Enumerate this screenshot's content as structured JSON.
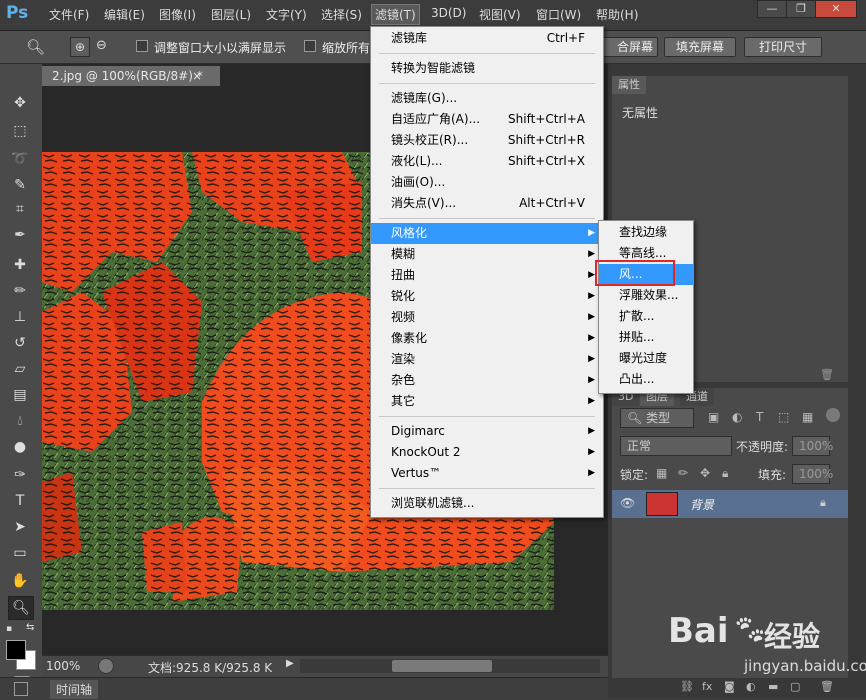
{
  "app": {
    "logo": "Ps"
  },
  "menubar": {
    "items": [
      "文件(F)",
      "编辑(E)",
      "图像(I)",
      "图层(L)",
      "文字(Y)",
      "选择(S)",
      "滤镜(T)",
      "3D(D)",
      "视图(V)",
      "窗口(W)",
      "帮助(H)"
    ],
    "active": "滤镜(T)"
  },
  "window_controls": {
    "minimize": "—",
    "restore": "❐",
    "close": "✕"
  },
  "options_bar": {
    "resize_window_label": "调整窗口大小以满屏显示",
    "zoom_all_label": "缩放所有",
    "fit_screen_label": "合屏幕",
    "fill_screen_label": "填充屏幕",
    "print_size_label": "打印尺寸"
  },
  "document": {
    "tab_title": "2.jpg @ 100%(RGB/8#) *",
    "tab_close": "×",
    "zoom": "100%",
    "doc_size": "文档:925.8 K/925.8 K"
  },
  "timeline_label": "时间轴",
  "filter_menu": {
    "items": [
      {
        "label": "滤镜库",
        "shortcut": "Ctrl+F"
      },
      {
        "label": "转换为智能滤镜",
        "shortcut": ""
      },
      {
        "label": "滤镜库(G)...",
        "shortcut": ""
      },
      {
        "label": "自适应广角(A)...",
        "shortcut": "Shift+Ctrl+A"
      },
      {
        "label": "镜头校正(R)...",
        "shortcut": "Shift+Ctrl+R"
      },
      {
        "label": "液化(L)...",
        "shortcut": "Shift+Ctrl+X"
      },
      {
        "label": "油画(O)...",
        "shortcut": ""
      },
      {
        "label": "消失点(V)...",
        "shortcut": "Alt+Ctrl+V"
      },
      {
        "label": "风格化",
        "shortcut": ""
      },
      {
        "label": "模糊",
        "shortcut": ""
      },
      {
        "label": "扭曲",
        "shortcut": ""
      },
      {
        "label": "锐化",
        "shortcut": ""
      },
      {
        "label": "视频",
        "shortcut": ""
      },
      {
        "label": "像素化",
        "shortcut": ""
      },
      {
        "label": "渲染",
        "shortcut": ""
      },
      {
        "label": "杂色",
        "shortcut": ""
      },
      {
        "label": "其它",
        "shortcut": ""
      },
      {
        "label": "Digimarc",
        "shortcut": ""
      },
      {
        "label": "KnockOut 2",
        "shortcut": ""
      },
      {
        "label": "Vertus™",
        "shortcut": ""
      },
      {
        "label": "浏览联机滤镜...",
        "shortcut": ""
      }
    ],
    "highlighted": "风格化"
  },
  "stylize_submenu": {
    "items": [
      "查找边缘",
      "等高线...",
      "风...",
      "浮雕效果...",
      "扩散...",
      "拼贴...",
      "曝光过度",
      "凸出..."
    ],
    "highlighted": "风..."
  },
  "properties_panel": {
    "tab": "属性",
    "content": "无属性"
  },
  "layers_panel": {
    "tabs": [
      "3D",
      "图层",
      "通道"
    ],
    "kind_filter": "类型",
    "blend_mode": "正常",
    "opacity_label": "不透明度:",
    "opacity_value": "100%",
    "lock_label": "锁定:",
    "fill_label": "填充:",
    "fill_value": "100%",
    "layer_name": "背景"
  },
  "watermark": {
    "brand": "Bai",
    "brand2": "经验",
    "url": "jingyan.baidu.com"
  },
  "colors": {
    "menu_highlight": "#3399ff",
    "red_box": "#e0262a",
    "ps_blue": "#5fb0ea"
  }
}
